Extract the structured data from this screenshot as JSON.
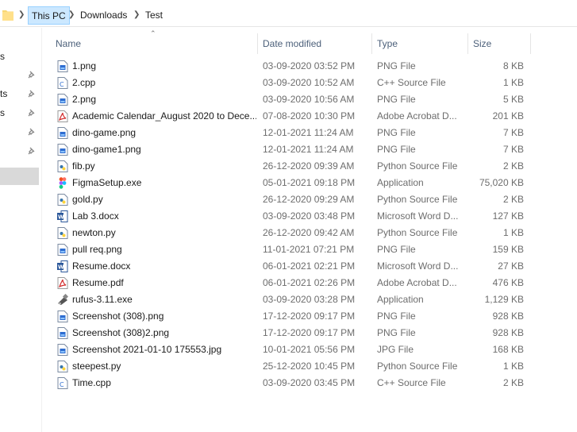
{
  "breadcrumb": {
    "items": [
      "This PC",
      "Downloads",
      "Test"
    ]
  },
  "nav_fragments": [
    "s",
    "ts",
    "s"
  ],
  "columns": {
    "name": "Name",
    "date": "Date modified",
    "type": "Type",
    "size": "Size"
  },
  "files": [
    {
      "name": "1.png",
      "date": "03-09-2020 03:52 PM",
      "type": "PNG File",
      "size": "8 KB",
      "icon": "png"
    },
    {
      "name": "2.cpp",
      "date": "03-09-2020 10:52 AM",
      "type": "C++ Source File",
      "size": "1 KB",
      "icon": "cpp"
    },
    {
      "name": "2.png",
      "date": "03-09-2020 10:56 AM",
      "type": "PNG File",
      "size": "5 KB",
      "icon": "png"
    },
    {
      "name": "Academic Calendar_August 2020 to Dece...",
      "date": "07-08-2020 10:30 PM",
      "type": "Adobe Acrobat D...",
      "size": "201 KB",
      "icon": "pdf"
    },
    {
      "name": "dino-game.png",
      "date": "12-01-2021 11:24 AM",
      "type": "PNG File",
      "size": "7 KB",
      "icon": "png"
    },
    {
      "name": "dino-game1.png",
      "date": "12-01-2021 11:24 AM",
      "type": "PNG File",
      "size": "7 KB",
      "icon": "png"
    },
    {
      "name": "fib.py",
      "date": "26-12-2020 09:39 AM",
      "type": "Python Source File",
      "size": "2 KB",
      "icon": "py"
    },
    {
      "name": "FigmaSetup.exe",
      "date": "05-01-2021 09:18 PM",
      "type": "Application",
      "size": "75,020 KB",
      "icon": "figma"
    },
    {
      "name": "gold.py",
      "date": "26-12-2020 09:29 AM",
      "type": "Python Source File",
      "size": "2 KB",
      "icon": "py"
    },
    {
      "name": "Lab 3.docx",
      "date": "03-09-2020 03:48 PM",
      "type": "Microsoft Word D...",
      "size": "127 KB",
      "icon": "word"
    },
    {
      "name": "newton.py",
      "date": "26-12-2020 09:42 AM",
      "type": "Python Source File",
      "size": "1 KB",
      "icon": "py"
    },
    {
      "name": "pull req.png",
      "date": "11-01-2021 07:21 PM",
      "type": "PNG File",
      "size": "159 KB",
      "icon": "png"
    },
    {
      "name": "Resume.docx",
      "date": "06-01-2021 02:21 PM",
      "type": "Microsoft Word D...",
      "size": "27 KB",
      "icon": "word"
    },
    {
      "name": "Resume.pdf",
      "date": "06-01-2021 02:26 PM",
      "type": "Adobe Acrobat D...",
      "size": "476 KB",
      "icon": "pdf"
    },
    {
      "name": "rufus-3.11.exe",
      "date": "03-09-2020 03:28 PM",
      "type": "Application",
      "size": "1,129 KB",
      "icon": "rufus"
    },
    {
      "name": "Screenshot (308).png",
      "date": "17-12-2020 09:17 PM",
      "type": "PNG File",
      "size": "928 KB",
      "icon": "png"
    },
    {
      "name": "Screenshot (308)2.png",
      "date": "17-12-2020 09:17 PM",
      "type": "PNG File",
      "size": "928 KB",
      "icon": "png"
    },
    {
      "name": "Screenshot 2021-01-10 175553.jpg",
      "date": "10-01-2021 05:56 PM",
      "type": "JPG File",
      "size": "168 KB",
      "icon": "png"
    },
    {
      "name": "steepest.py",
      "date": "25-12-2020 10:45 PM",
      "type": "Python Source File",
      "size": "1 KB",
      "icon": "py"
    },
    {
      "name": "Time.cpp",
      "date": "03-09-2020 03:45 PM",
      "type": "C++ Source File",
      "size": "2 KB",
      "icon": "cpp"
    }
  ],
  "colors": {
    "accent": "#0078d7",
    "selection": "#cce8ff",
    "pdf": "#d32f2f",
    "word": "#2b579a"
  }
}
